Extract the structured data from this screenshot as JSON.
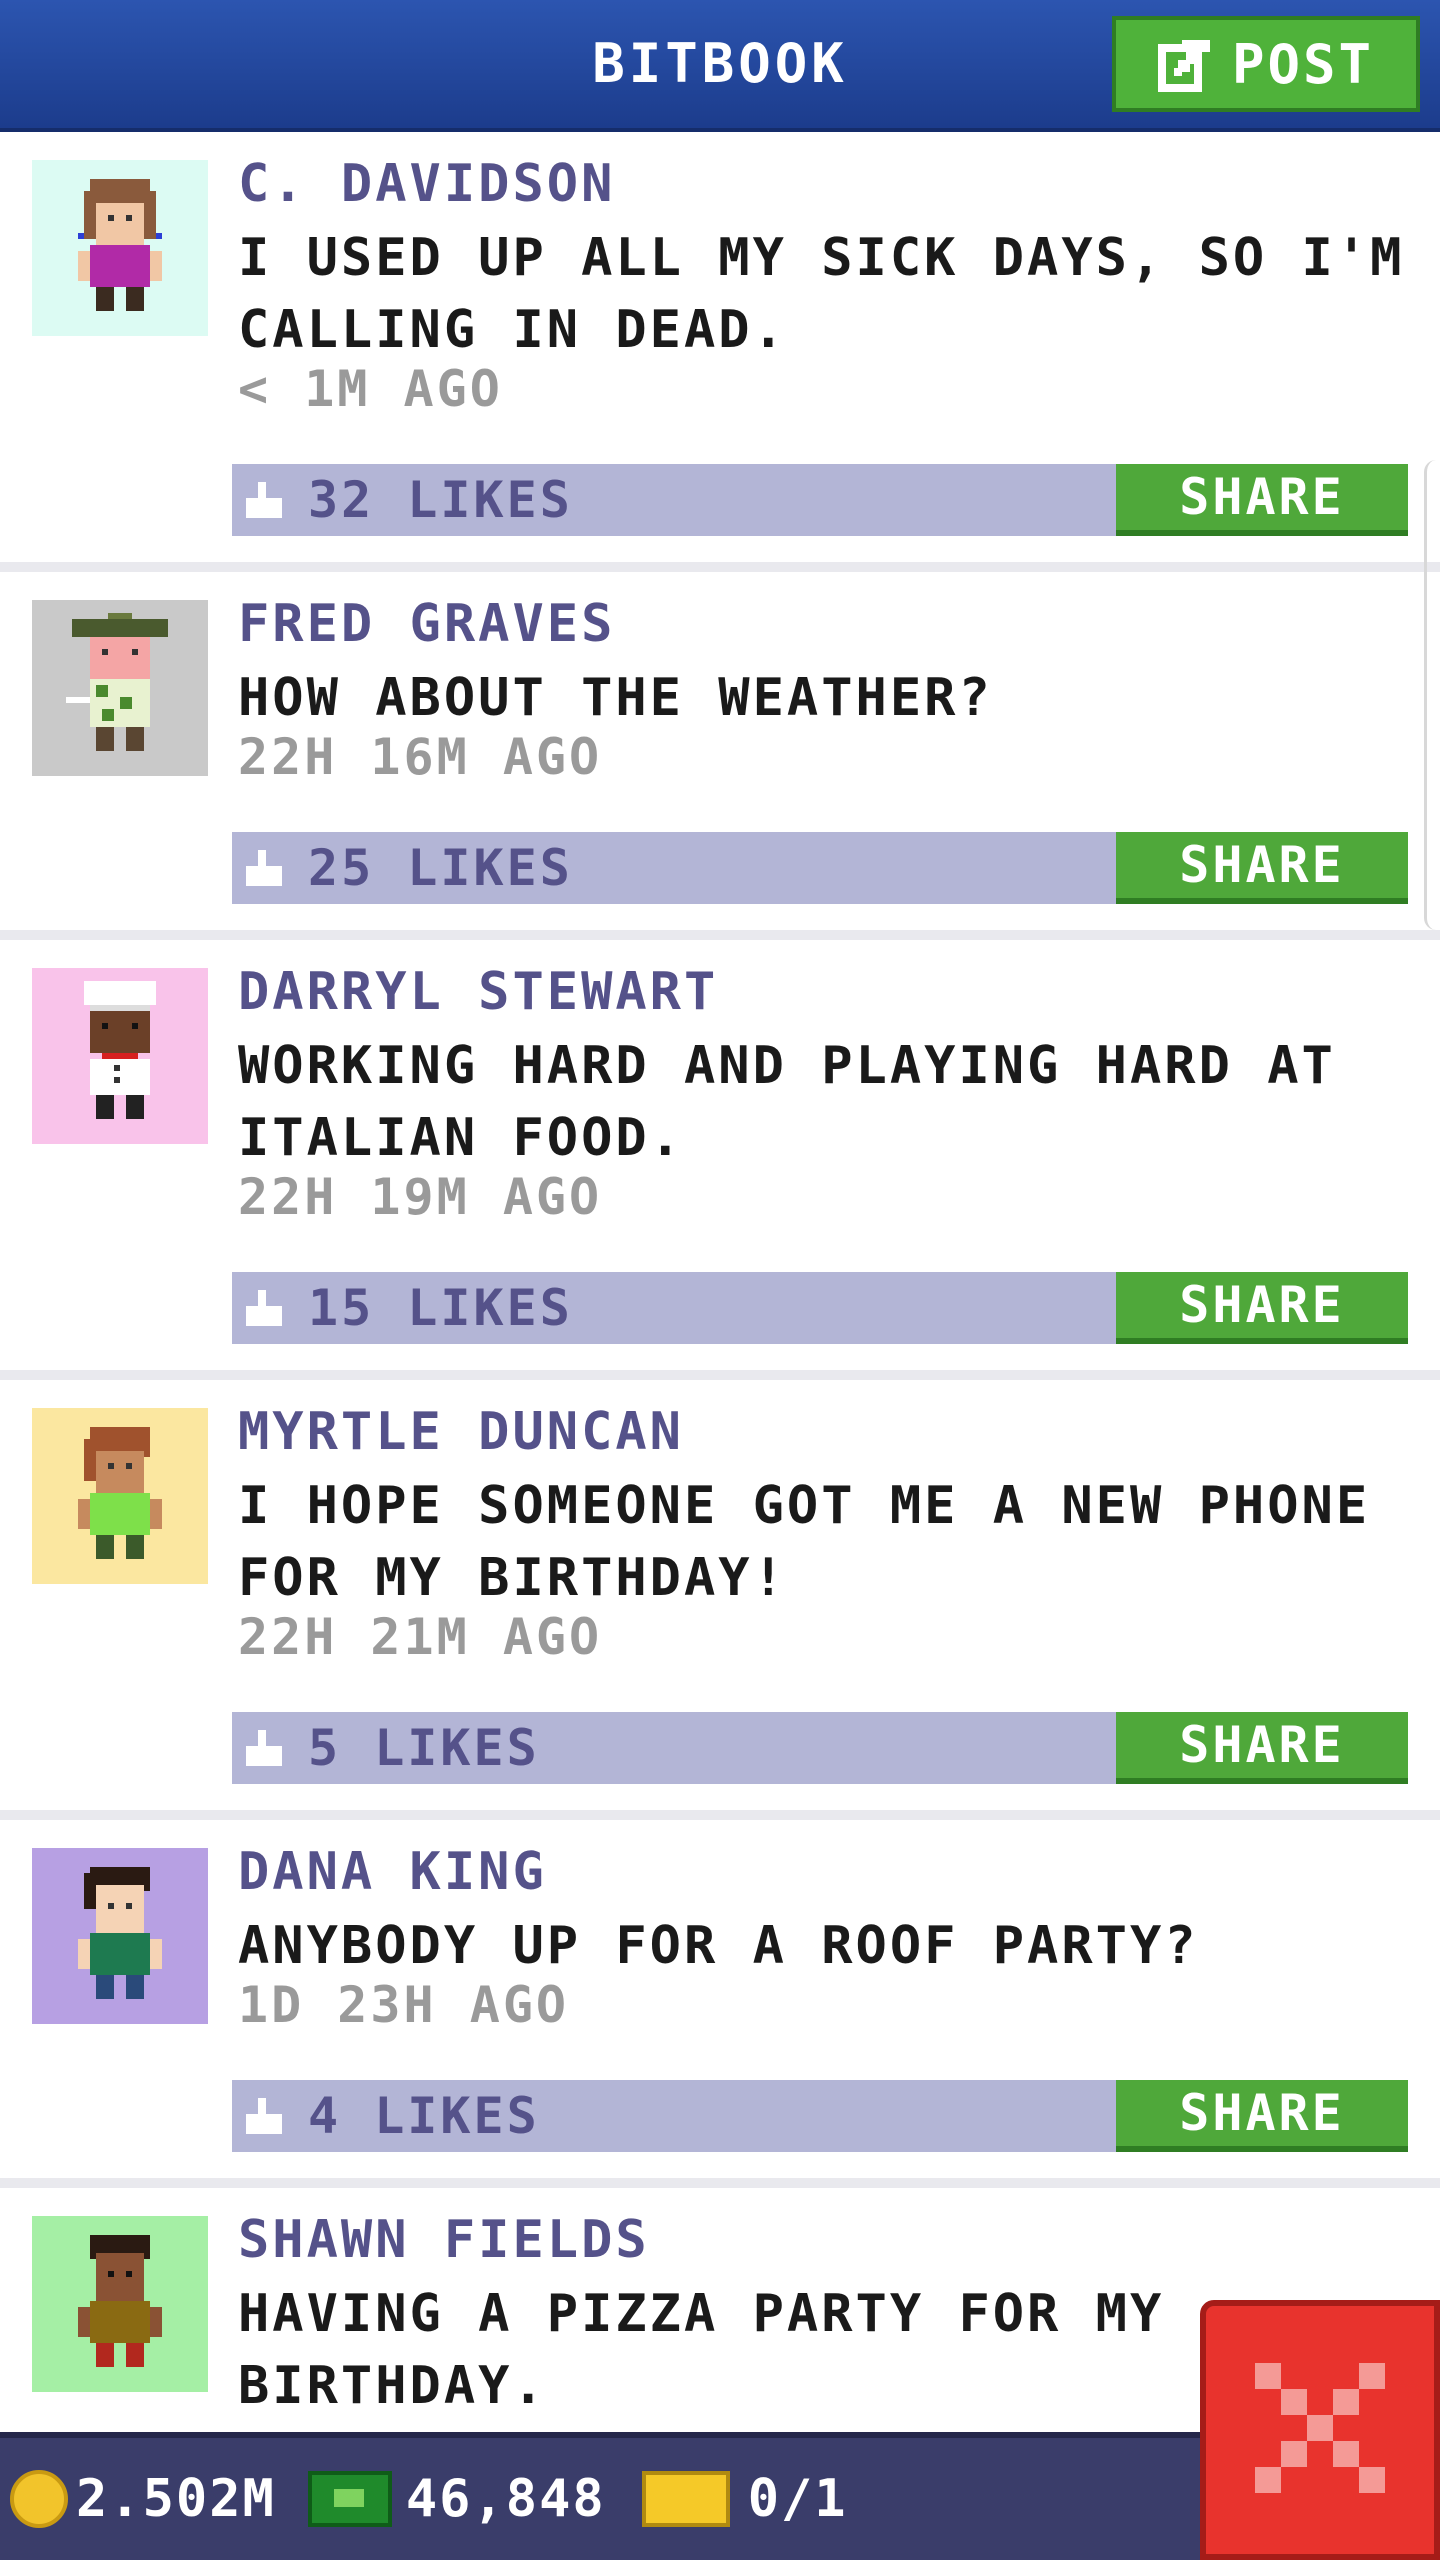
{
  "app": {
    "title": "BITBOOK",
    "post_button_label": "POST"
  },
  "posts": [
    {
      "author": "C. DAVIDSON",
      "text": "I USED UP ALL MY SICK DAYS, SO I'M CALLING IN DEAD.",
      "time": "< 1M AGO",
      "likes": "32 LIKES",
      "share_label": "SHARE",
      "avatar_bg": "#dcfbf3"
    },
    {
      "author": "FRED GRAVES",
      "text": "HOW ABOUT THE WEATHER?",
      "time": "22H 16M AGO",
      "likes": "25 LIKES",
      "share_label": "SHARE",
      "avatar_bg": "#c9c9c9"
    },
    {
      "author": "DARRYL STEWART",
      "text": "WORKING HARD AND PLAYING HARD AT ITALIAN FOOD.",
      "time": "22H 19M AGO",
      "likes": "15 LIKES",
      "share_label": "SHARE",
      "avatar_bg": "#f9c3ea"
    },
    {
      "author": "MYRTLE DUNCAN",
      "text": "I HOPE SOMEONE GOT ME A NEW PHONE FOR MY BIRTHDAY!",
      "time": "22H 21M AGO",
      "likes": "5 LIKES",
      "share_label": "SHARE",
      "avatar_bg": "#fbe7a0"
    },
    {
      "author": "DANA KING",
      "text": "ANYBODY UP FOR A ROOF PARTY?",
      "time": "1D 23H AGO",
      "likes": "4 LIKES",
      "share_label": "SHARE",
      "avatar_bg": "#b7a0e3"
    },
    {
      "author": "SHAWN FIELDS",
      "text": "HAVING A PIZZA PARTY FOR MY BIRTHDAY.",
      "time": "",
      "likes": "",
      "share_label": "",
      "avatar_bg": "#a5efa5"
    }
  ],
  "status": {
    "coins": "2.502M",
    "bux": "46,848",
    "tickets": "0/1"
  },
  "icons": {
    "post": "edit-icon",
    "like": "thumbs-up-icon",
    "close": "close-icon",
    "coin": "coin-icon",
    "bux": "bux-icon",
    "ticket": "ticket-icon"
  },
  "colors": {
    "header": "#2c55b0",
    "green_button": "#4fb23a",
    "likes_bar": "#b3b5d6",
    "name": "#55528a",
    "close": "#e8332d",
    "status_bar": "#3a3d6a"
  }
}
